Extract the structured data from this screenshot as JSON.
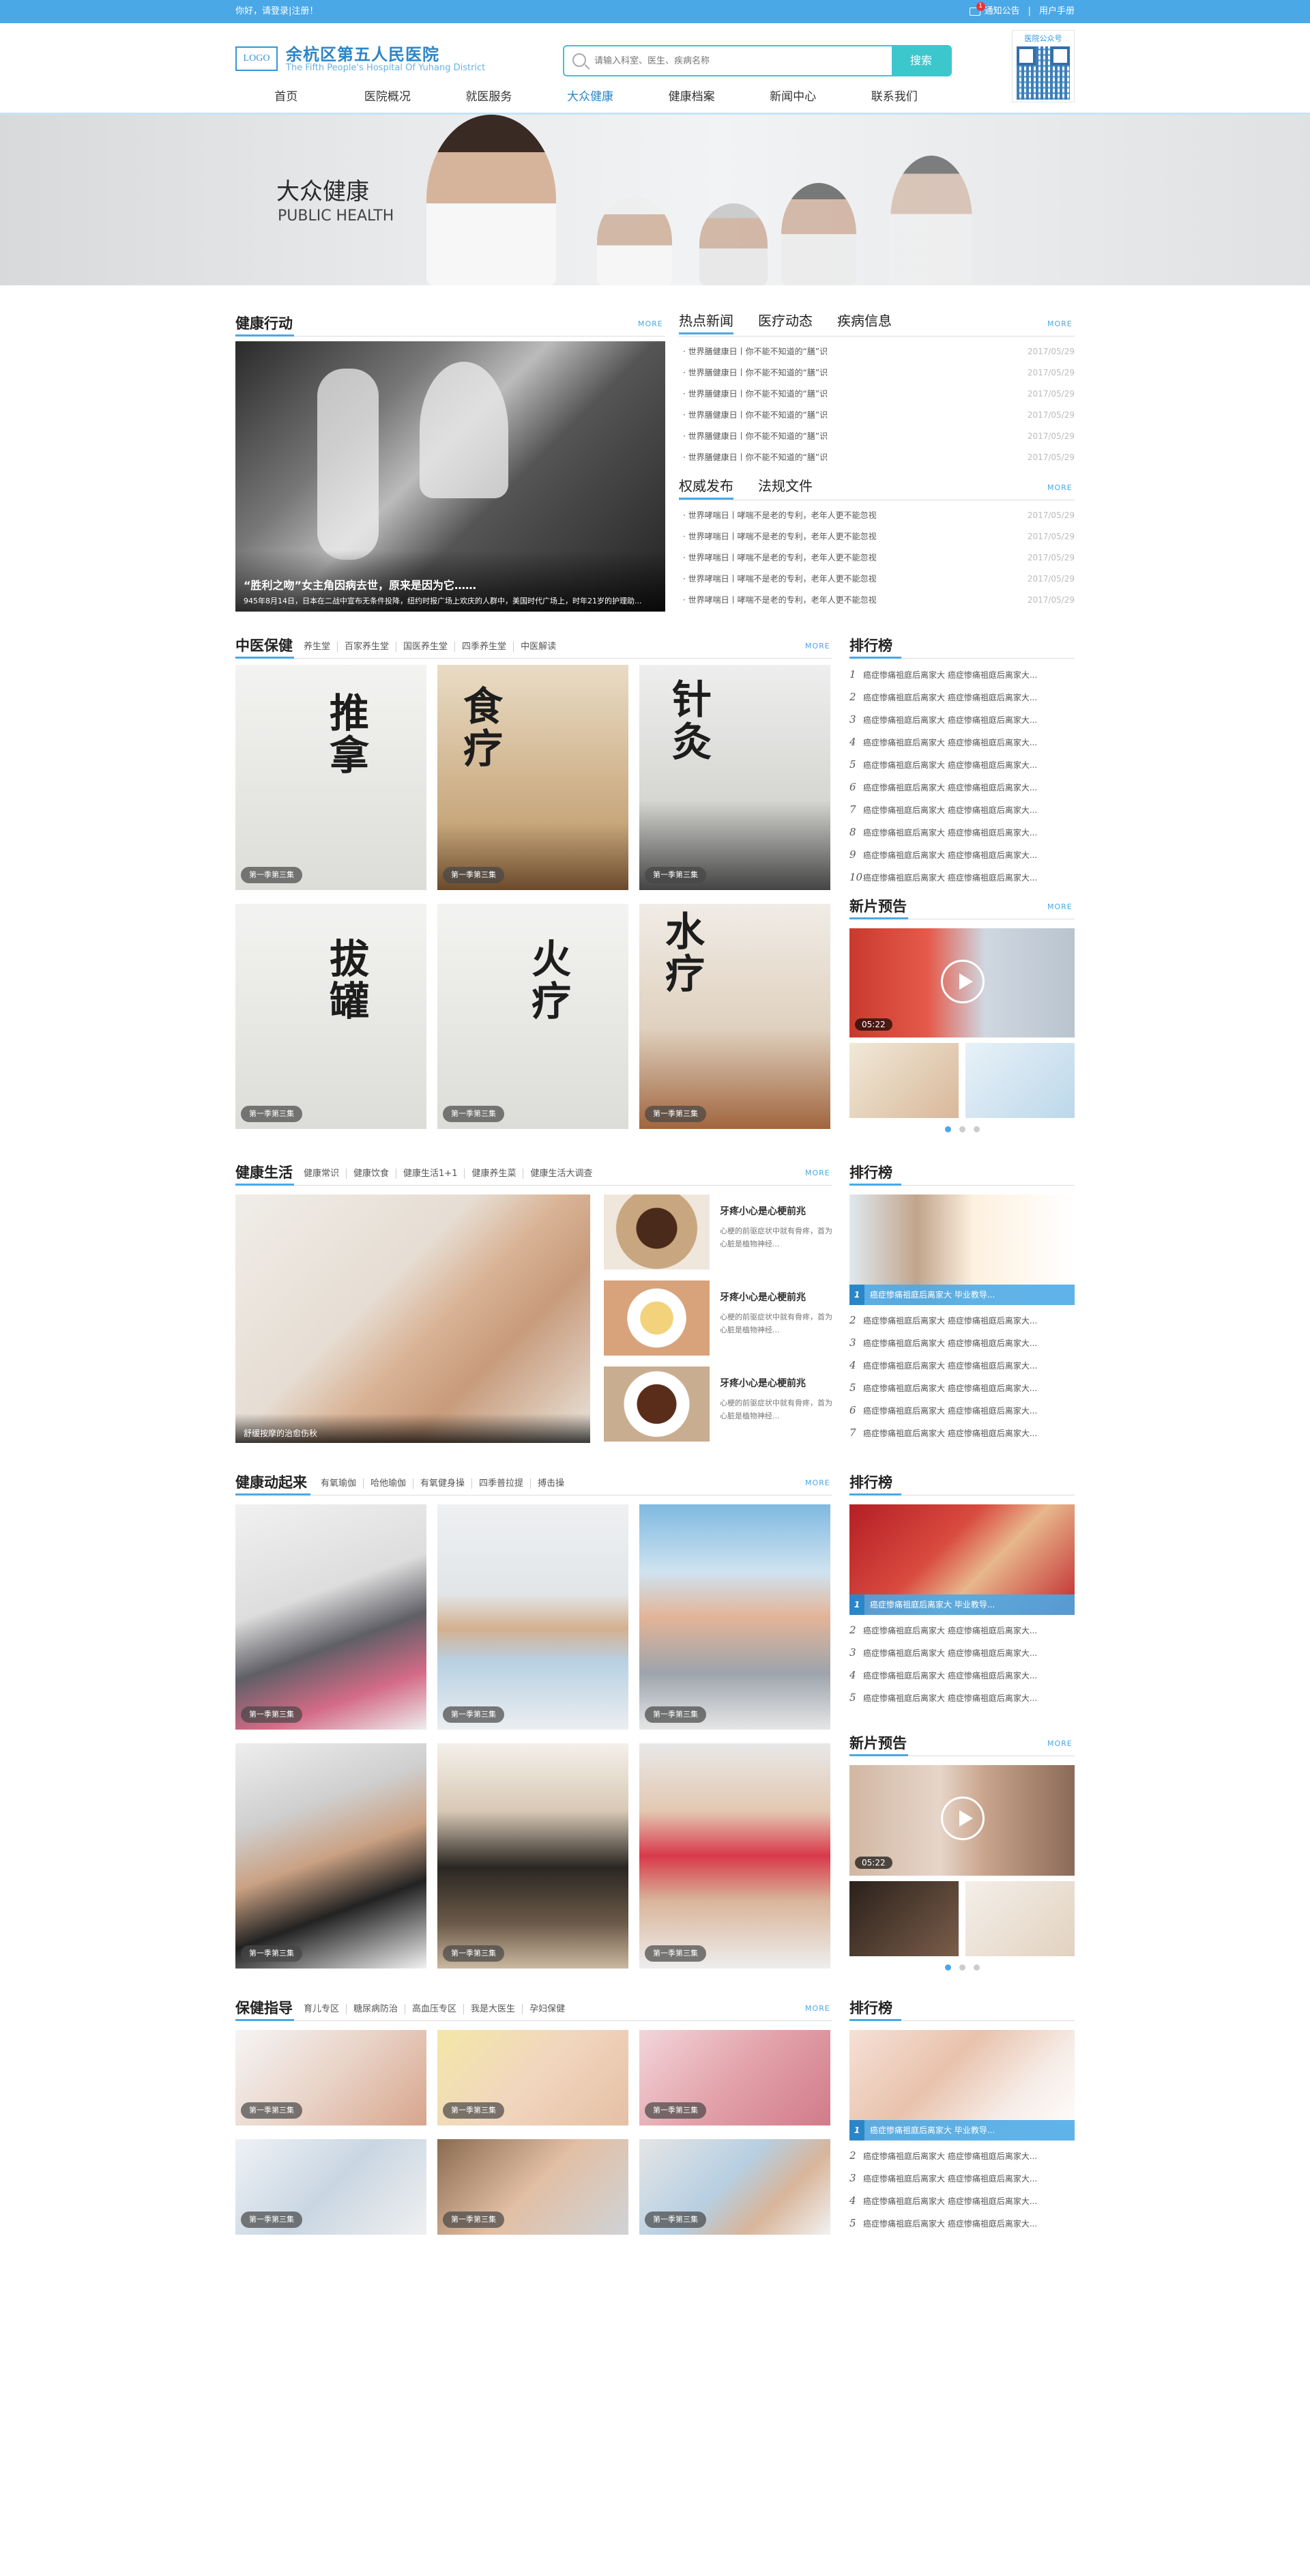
{
  "topbar": {
    "greeting": "你好，请登录|注册！",
    "notice": "通知公告",
    "notice_count": "1",
    "sep": "|",
    "manual": "用户手册"
  },
  "header": {
    "logo": "LOGO",
    "name": "余杭区第五人民医院",
    "name_en": "The Fifth People's Hospital Of Yuhang District",
    "search_placeholder": "请输入科室、医生、疾病名称",
    "search_btn": "搜索",
    "qr_label": "医院公众号"
  },
  "nav": [
    "首页",
    "医院概况",
    "就医服务",
    "大众健康",
    "健康档案",
    "新闻中心",
    "联系我们"
  ],
  "hero": {
    "title": "大众健康",
    "subtitle": "PUBLIC HEALTH"
  },
  "more": "MORE",
  "action": {
    "title": "健康行动",
    "caption_title": "“胜利之吻”女主角因病去世，原来是因为它……",
    "caption_desc": "945年8月14日，日本在二战中宣布无条件投降，纽约时报广场上欢庆的人群中，美国时代广场上，时年21岁的护理助..."
  },
  "news": {
    "tabs": [
      "热点新闻",
      "医疗动态",
      "疾病信息"
    ],
    "items": [
      {
        "t": "· 世界膳健康日丨你不能不知道的“膳”识",
        "d": "2017/05/29"
      },
      {
        "t": "· 世界膳健康日丨你不能不知道的“膳”识",
        "d": "2017/05/29"
      },
      {
        "t": "· 世界膳健康日丨你不能不知道的“膳”识",
        "d": "2017/05/29"
      },
      {
        "t": "· 世界膳健康日丨你不能不知道的“膳”识",
        "d": "2017/05/29"
      },
      {
        "t": "· 世界膳健康日丨你不能不知道的“膳”识",
        "d": "2017/05/29"
      },
      {
        "t": "· 世界膳健康日丨你不能不知道的“膳”识",
        "d": "2017/05/29"
      }
    ]
  },
  "authority": {
    "tabs": [
      "权威发布",
      "法规文件"
    ],
    "items": [
      {
        "t": "· 世界哮喘日丨哮喘不是老的专利，老年人更不能忽视",
        "d": "2017/05/29"
      },
      {
        "t": "· 世界哮喘日丨哮喘不是老的专利，老年人更不能忽视",
        "d": "2017/05/29"
      },
      {
        "t": "· 世界哮喘日丨哮喘不是老的专利，老年人更不能忽视",
        "d": "2017/05/29"
      },
      {
        "t": "· 世界哮喘日丨哮喘不是老的专利，老年人更不能忽视",
        "d": "2017/05/29"
      },
      {
        "t": "· 世界哮喘日丨哮喘不是老的专利，老年人更不能忽视",
        "d": "2017/05/29"
      }
    ]
  },
  "tcm": {
    "title": "中医保健",
    "subtabs": [
      "养生堂",
      "百家养生堂",
      "国医养生堂",
      "四季养生堂",
      "中医解读"
    ],
    "posters": [
      {
        "t": "推拿",
        "p": "第一季第三集"
      },
      {
        "t": "食疗",
        "p": "第一季第三集"
      },
      {
        "t": "针灸",
        "p": "第一季第三集"
      },
      {
        "t": "拔罐",
        "p": "第一季第三集"
      },
      {
        "t": "火疗",
        "p": "第一季第三集"
      },
      {
        "t": "水疗",
        "p": "第一季第三集"
      }
    ]
  },
  "rank_title": "排行榜",
  "rank1": [
    "1",
    "2",
    "3",
    "4",
    "5",
    "6",
    "7",
    "8",
    "9",
    "10"
  ],
  "rank_text": "癌症惨痛祖庭后离家大  癌症惨痛祖庭后离家大...",
  "rank_banner": "癌症惨痛祖庭后离家大 毕业教导...",
  "preview": {
    "title": "新片预告",
    "dur": "05:22"
  },
  "life": {
    "title": "健康生活",
    "subtabs": [
      "健康常识",
      "健康饮食",
      "健康生活1+1",
      "健康养生菜",
      "健康生活大调查"
    ],
    "caption": "舒缓按摩的治愈伤秋",
    "items": [
      {
        "t": "牙疼小心是心梗前兆",
        "d": "心梗的前驱症状中就有骨疼，首为心脏是植物神经..."
      },
      {
        "t": "牙疼小心是心梗前兆",
        "d": "心梗的前驱症状中就有骨疼，首为心脏是植物神经..."
      },
      {
        "t": "牙疼小心是心梗前兆",
        "d": "心梗的前驱症状中就有骨疼，首为心脏是植物神经..."
      }
    ]
  },
  "rank2": [
    "2",
    "3",
    "4",
    "5",
    "6",
    "7"
  ],
  "sport": {
    "title": "健康动起来",
    "subtabs": [
      "有氧瑜伽",
      "哈他瑜伽",
      "有氧健身操",
      "四季普拉提",
      "搏击操"
    ],
    "pill": "第一季第三集"
  },
  "rank3": [
    "2",
    "3",
    "4",
    "5"
  ],
  "care": {
    "title": "保健指导",
    "subtabs": [
      "育儿专区",
      "糖尿病防治",
      "高血压专区",
      "我是大医生",
      "孕妇保健"
    ],
    "pill": "第一季第三集"
  },
  "rank4": [
    "2",
    "3",
    "4",
    "5"
  ],
  "colors": {
    "brand": "#4aa8e6",
    "teal": "#3cc7cc",
    "dark_blue": "#2b86c8"
  }
}
